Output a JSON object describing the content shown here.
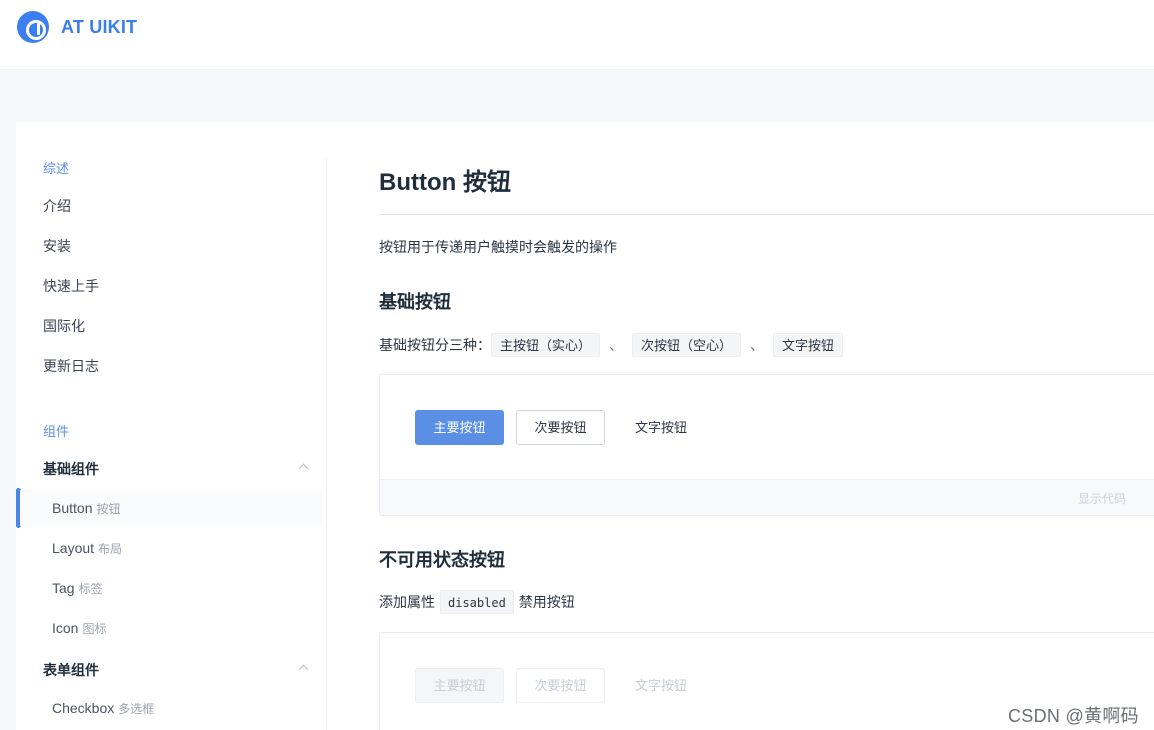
{
  "header": {
    "brand": "AT UIKIT",
    "logo_icon": "logo-a-icon"
  },
  "sidebar": {
    "group_overview": "综述",
    "overview_items": [
      {
        "label": "介绍"
      },
      {
        "label": "安装"
      },
      {
        "label": "快速上手"
      },
      {
        "label": "国际化"
      },
      {
        "label": "更新日志"
      }
    ],
    "group_components": "组件",
    "basic_components": {
      "title": "基础组件",
      "expanded": true,
      "items": [
        {
          "en": "Button",
          "cn": "按钮",
          "active": true
        },
        {
          "en": "Layout",
          "cn": "布局"
        },
        {
          "en": "Tag",
          "cn": "标签"
        },
        {
          "en": "Icon",
          "cn": "图标"
        }
      ]
    },
    "form_components": {
      "title": "表单组件",
      "expanded": true,
      "items": [
        {
          "en": "Checkbox",
          "cn": "多选框"
        }
      ]
    }
  },
  "content": {
    "title": "Button 按钮",
    "lead": "按钮用于传递用户触摸时会触发的操作",
    "basic": {
      "heading": "基础按钮",
      "desc_prefix": "基础按钮分三种：",
      "tag1": "主按钮（实心）",
      "tag2": "次按钮（空心）",
      "tag3": "文字按钮",
      "separator": "、",
      "buttons": {
        "primary": "主要按钮",
        "secondary": "次要按钮",
        "text": "文字按钮"
      },
      "show_code": "显示代码"
    },
    "disabled": {
      "heading": "不可用状态按钮",
      "desc_prefix": "添加属性",
      "code": "disabled",
      "desc_suffix": "禁用按钮",
      "buttons": {
        "primary": "主要按钮",
        "secondary": "次要按钮",
        "text": "文字按钮"
      }
    }
  },
  "watermark": "CSDN @黄啊码",
  "colors": {
    "brand": "#3b7ef0",
    "primary_button": "#5b8fe6",
    "group_title": "#5a8fe8"
  }
}
